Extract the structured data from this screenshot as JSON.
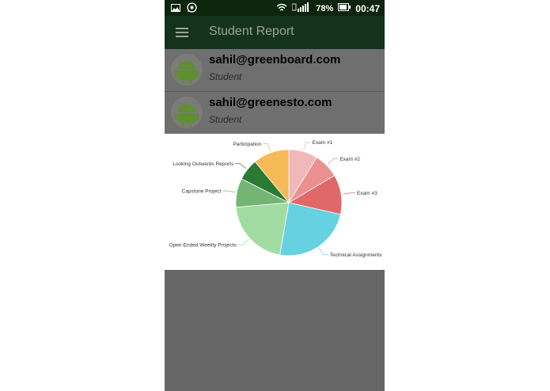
{
  "status_bar": {
    "icons": [
      "gallery-icon",
      "whatsapp-icon",
      "wifi-icon",
      "signal-icon",
      "battery-icon"
    ],
    "battery": "78%",
    "time": "00:47"
  },
  "toolbar": {
    "title": "Student Report"
  },
  "students": [
    {
      "email": "sahil@greenboard.com",
      "role": "Student"
    },
    {
      "email": "sahil@greenesto.com",
      "role": "Student"
    }
  ],
  "colors": {
    "status_bar": "#0d250d",
    "toolbar": "#15331a",
    "overlay": "#666666",
    "android_green": "#5f8f2f"
  },
  "chart_data": {
    "type": "pie",
    "categories": [
      "Exam #1",
      "Exam #2",
      "Exam #3",
      "Technical Assignments",
      "Open-Ended Weekly Projects",
      "Capstone Project",
      "Looking Outwards Reports",
      "Participation"
    ],
    "values": [
      8,
      7,
      11,
      22,
      19,
      8,
      6,
      10
    ],
    "colors": [
      "#f0b8b8",
      "#eb9090",
      "#e06868",
      "#66d1e0",
      "#a2dca2",
      "#74b474",
      "#2b7a33",
      "#f5b955"
    ],
    "legend": "none"
  }
}
